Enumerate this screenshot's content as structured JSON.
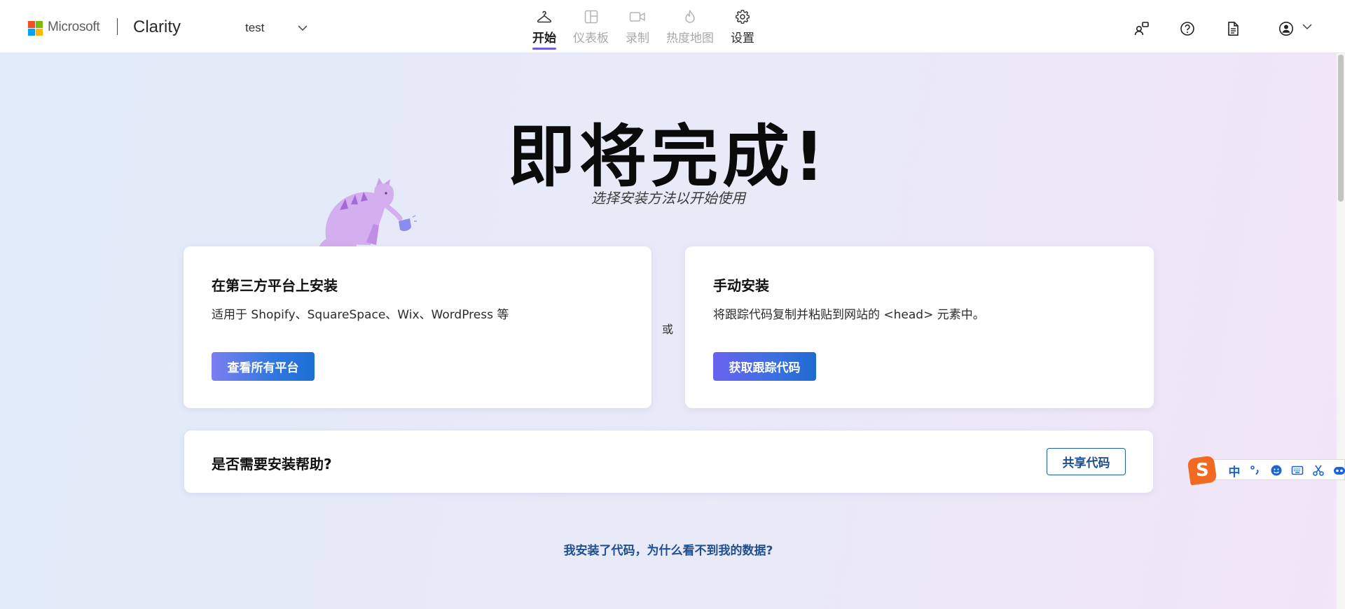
{
  "header": {
    "brand_company": "Microsoft",
    "brand_product": "Clarity",
    "project_name": "test",
    "nav": [
      {
        "label": "开始",
        "icon": "hanger-icon",
        "state": "active"
      },
      {
        "label": "仪表板",
        "icon": "dashboard-icon",
        "state": "disabled"
      },
      {
        "label": "录制",
        "icon": "video-camera-icon",
        "state": "disabled"
      },
      {
        "label": "热度地图",
        "icon": "flame-icon",
        "state": "disabled"
      },
      {
        "label": "设置",
        "icon": "gear-icon",
        "state": "normal"
      }
    ],
    "right_icons": [
      "people-share-icon",
      "help-icon",
      "document-icon",
      "account-icon"
    ]
  },
  "hero": {
    "title": "即将完成!",
    "subtitle": "选择安装方法以开始使用"
  },
  "cards": {
    "platform": {
      "title": "在第三方平台上安装",
      "description": "适用于 Shopify、SquareSpace、Wix、WordPress 等",
      "button": "查看所有平台"
    },
    "or_label": "或",
    "manual": {
      "title": "手动安装",
      "description": "将跟踪代码复制并粘贴到网站的 <head> 元素中。",
      "button": "获取跟踪代码"
    }
  },
  "help": {
    "title": "是否需要安装帮助?",
    "button": "共享代码"
  },
  "faq_link": "我安装了代码，为什么看不到我的数据?",
  "ime": {
    "logo_letter": "S",
    "mode_label": "中",
    "items": [
      "punctuation-icon",
      "emoji-icon",
      "keyboard-icon",
      "scissors-icon",
      "robot-icon"
    ]
  },
  "colors": {
    "accent": "#6b5cf0",
    "link": "#1f4f8f",
    "button_gradient_start": "#7d7ff0",
    "button_gradient_end": "#1c6fd6"
  }
}
